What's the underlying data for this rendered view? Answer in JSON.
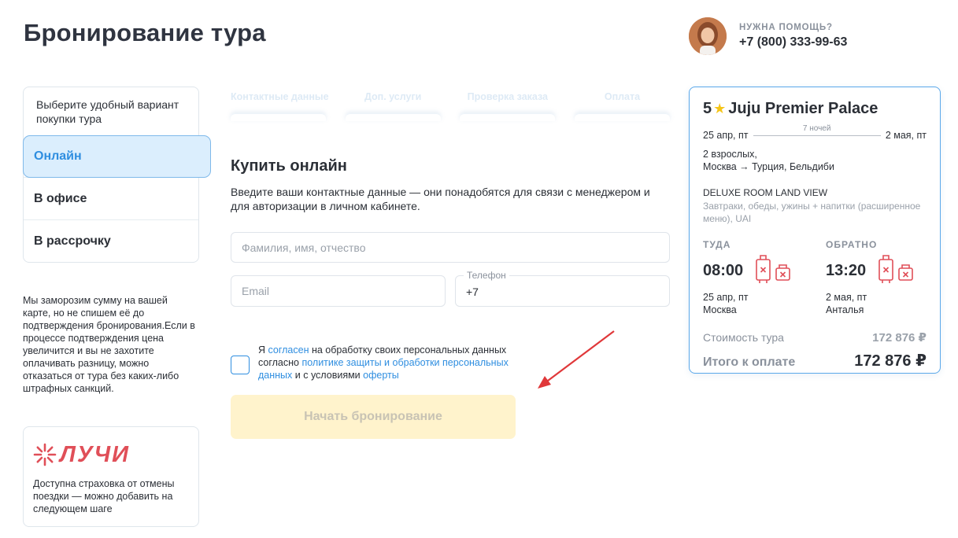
{
  "page": {
    "title": "Бронирование тура"
  },
  "help": {
    "caption": "НУЖНА ПОМОЩЬ?",
    "phone": "+7 (800) 333-99-63"
  },
  "purchase_options": {
    "hint": "Выберите удобный вариант покупки тура",
    "items": [
      {
        "label": "Онлайн",
        "active": true
      },
      {
        "label": "В офисе",
        "active": false
      },
      {
        "label": "В рассрочку",
        "active": false
      }
    ]
  },
  "freeze_note": "Мы заморозим сумму на вашей карте, но не спишем её до подтверждения бронирования.Если в процессе подтверждения цена увеличится и вы не захотите оплачивать разницу, можно отказаться от тура без каких-либо штрафных санкций.",
  "insurance": {
    "logo_text": "ЛУЧИ",
    "text": "Доступна страховка от отмены поездки — можно добавить на следующем шаге"
  },
  "steps": [
    "Контактные данные",
    "Доп. услуги",
    "Проверка заказа",
    "Оплата"
  ],
  "form": {
    "title": "Купить онлайн",
    "description": "Введите ваши контактные данные — они понадобятся для связи с менеджером и для авторизации в личном кабинете.",
    "fio_placeholder": "Фамилия, имя, отчество",
    "email_placeholder": "Email",
    "phone_label": "Телефон",
    "phone_value": "+7",
    "agree": {
      "t1": "Я ",
      "link1": "согласен",
      "t2": " на обработку своих персональных данных согласно ",
      "link2": "политике защиты и обработки персональных данных",
      "t3": " и с условиями ",
      "link3": "оферты"
    },
    "submit_label": "Начать бронирование"
  },
  "summary": {
    "stars": "5",
    "hotel_name": "Juju Premier Palace",
    "date_from": "25 апр, пт",
    "nights": "7 ночей",
    "date_to": "2 мая, пт",
    "guests": "2 взрослых,",
    "route": "Москва → Турция, Бельдиби",
    "room": "DELUXE ROOM LAND VIEW",
    "meal": "Завтраки, обеды, ужины + напитки (расширенное меню), UAI",
    "outbound": {
      "dir": "ТУДА",
      "time": "08:00",
      "date": "25 апр, пт",
      "city": "Москва"
    },
    "return": {
      "dir": "ОБРАТНО",
      "time": "13:20",
      "date": "2 мая, пт",
      "city": "Анталья"
    },
    "cost_label": "Стоимость тура",
    "cost_value": "172 876 ₽",
    "total_label": "Итого к оплате",
    "total_value": "172 876 ₽"
  },
  "colors": {
    "accent": "#2f8ee0",
    "button_disabled": "#fff3cc",
    "arrow": "#e0383a",
    "luggage": "#e04f58"
  }
}
